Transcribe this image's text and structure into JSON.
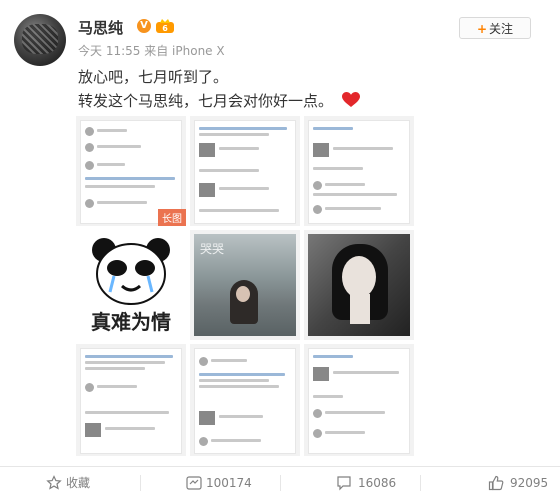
{
  "post": {
    "username": "马思纯",
    "verified_badge": "V",
    "vip_icon": "crown-vip-icon",
    "timestamp": "今天 11:55",
    "source": "来自 iPhone X",
    "text_line1": "放心吧，七月听到了。",
    "text_line2": "转发这个马思纯，七月会对你好一点。",
    "follow_label": "关注",
    "follow_icon": "plus-icon",
    "heart_icon": "red-heart-emoji",
    "accent_color": "#ff8200",
    "verified_color": "#f7931e"
  },
  "images": {
    "long_image_badge": "长图",
    "meme_caption": "真难为情",
    "photo_watermark": "哭哭"
  },
  "actions": {
    "favorite_label": "收藏",
    "favorite_icon": "star-outline-icon",
    "repost_count": "100174",
    "repost_icon": "repost-icon",
    "comment_count": "16086",
    "comment_icon": "comment-icon",
    "like_count": "92095",
    "like_icon": "thumbs-up-icon"
  }
}
